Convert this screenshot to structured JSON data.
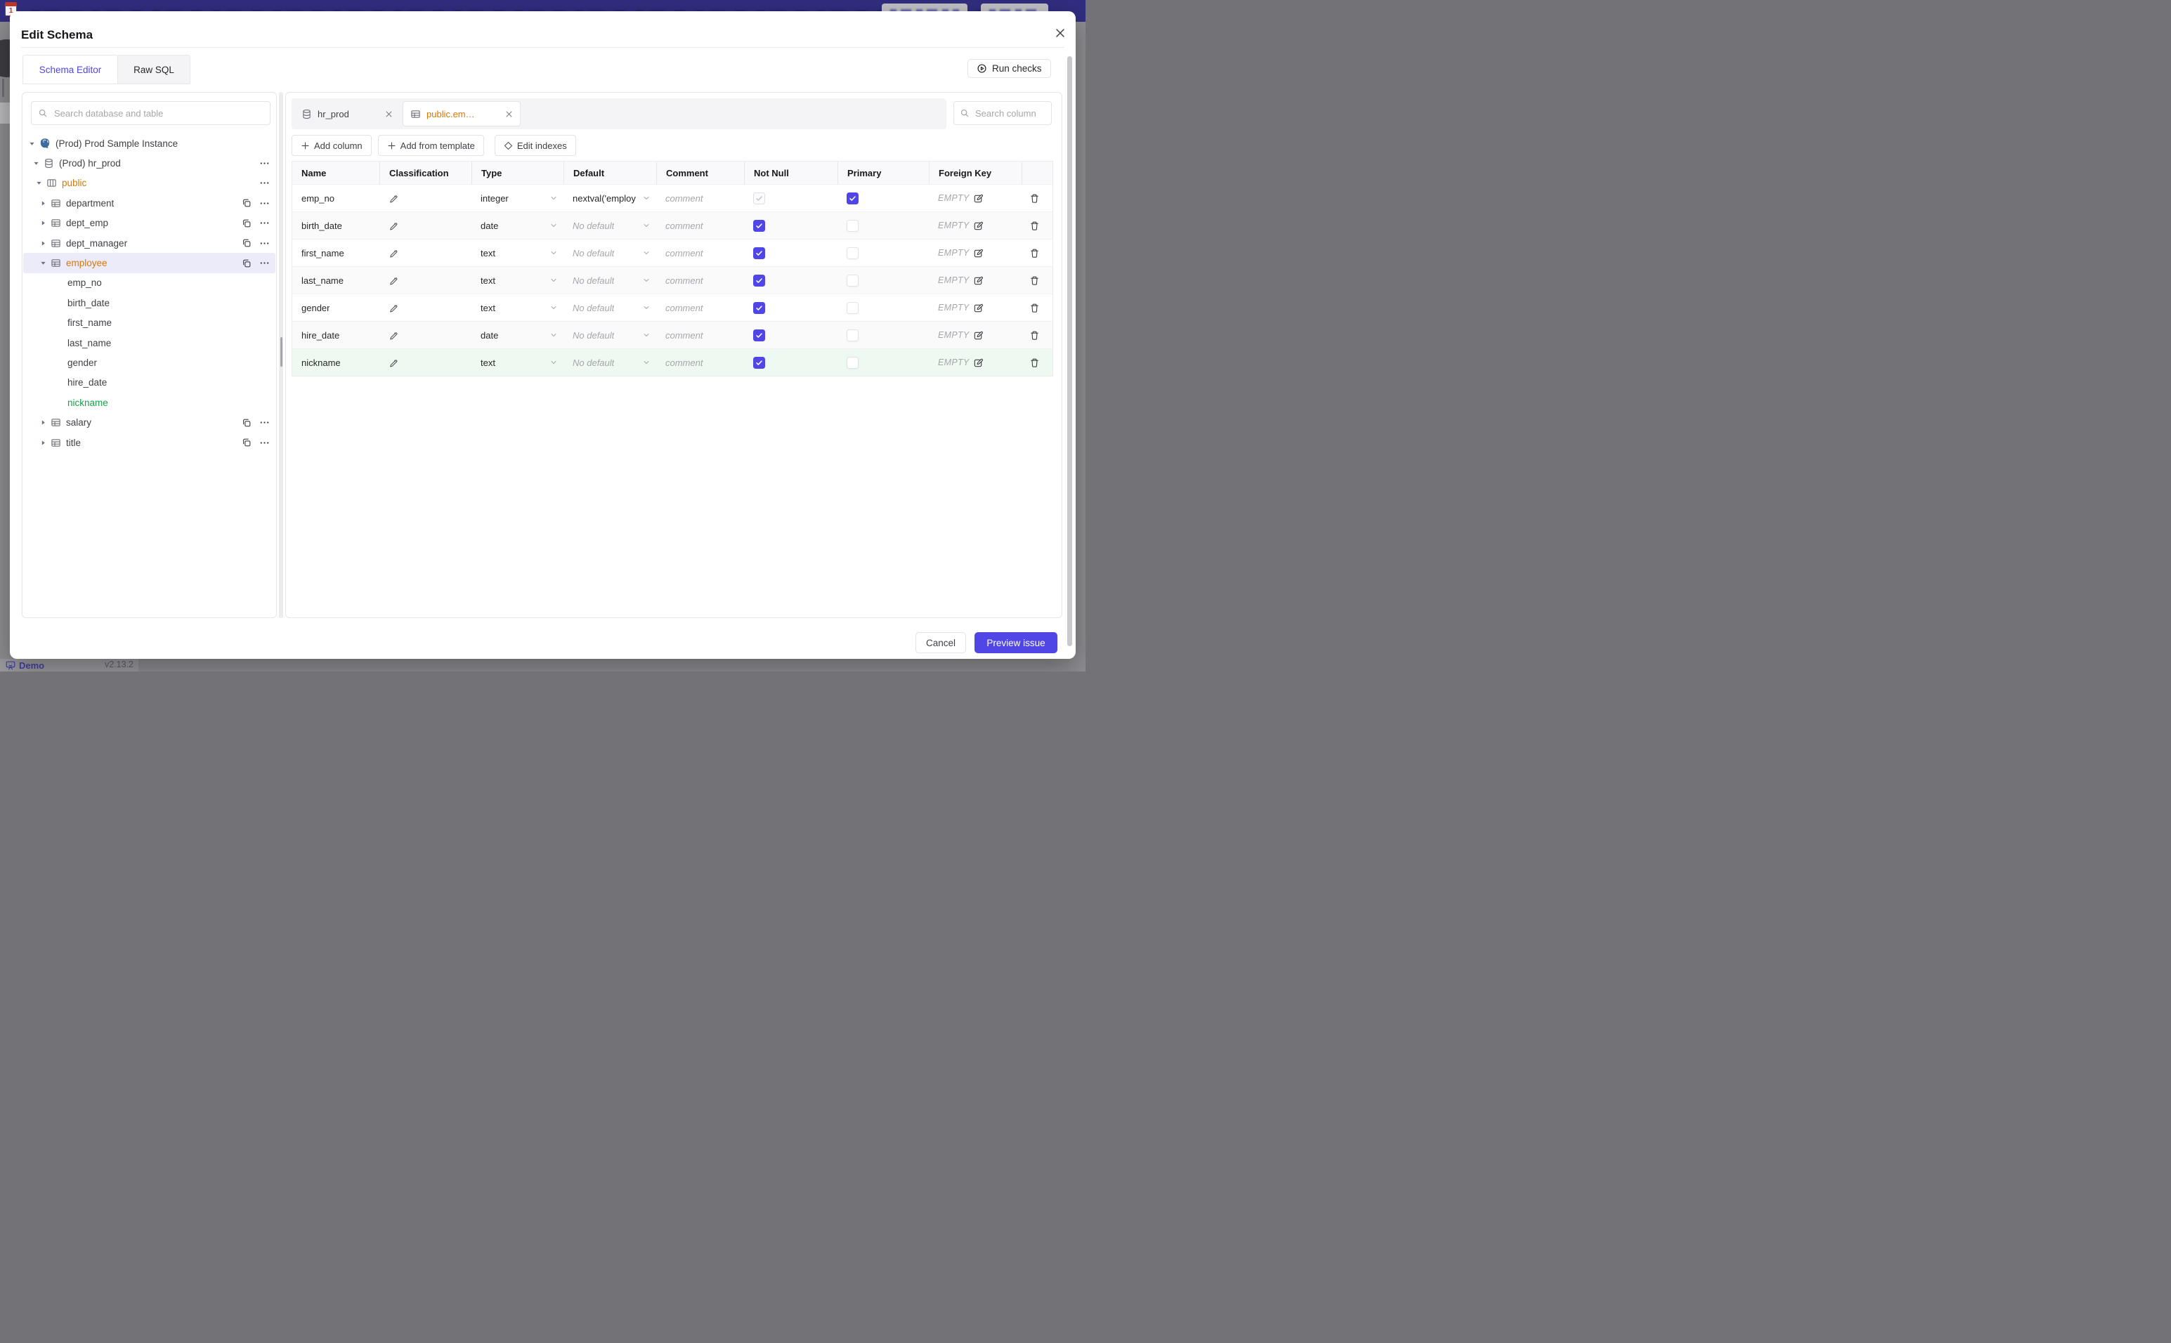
{
  "background": {
    "demo_label": "Demo",
    "version": "v2.13.2",
    "topbar_color": "#312e81"
  },
  "modal": {
    "title": "Edit Schema",
    "tabs": [
      {
        "label": "Schema Editor",
        "active": true
      },
      {
        "label": "Raw SQL",
        "active": false
      }
    ],
    "run_checks_label": "Run checks"
  },
  "sidebar": {
    "search_placeholder": "Search database and table",
    "tree": [
      {
        "level": 1,
        "caret": "down",
        "icon": "postgres-icon",
        "label": "(Prod) Prod Sample Instance"
      },
      {
        "level": 2,
        "caret": "down",
        "icon": "database-icon",
        "label": "(Prod) hr_prod",
        "actions": [
          "ellipsis"
        ]
      },
      {
        "level": 3,
        "caret": "down",
        "icon": "schema-icon",
        "label": "public",
        "color": "amber",
        "actions": [
          "ellipsis"
        ]
      },
      {
        "level": 4,
        "caret": "right",
        "icon": "table-icon",
        "label": "department",
        "actions": [
          "copy",
          "ellipsis"
        ]
      },
      {
        "level": 4,
        "caret": "right",
        "icon": "table-icon",
        "label": "dept_emp",
        "actions": [
          "copy",
          "ellipsis"
        ]
      },
      {
        "level": 4,
        "caret": "right",
        "icon": "table-icon",
        "label": "dept_manager",
        "actions": [
          "copy",
          "ellipsis"
        ]
      },
      {
        "level": 4,
        "caret": "down",
        "icon": "table-icon",
        "label": "employee",
        "color": "amber",
        "selected": true,
        "actions": [
          "copy",
          "ellipsis"
        ]
      },
      {
        "level": 5,
        "label": "emp_no"
      },
      {
        "level": 5,
        "label": "birth_date"
      },
      {
        "level": 5,
        "label": "first_name"
      },
      {
        "level": 5,
        "label": "last_name"
      },
      {
        "level": 5,
        "label": "gender"
      },
      {
        "level": 5,
        "label": "hire_date"
      },
      {
        "level": 5,
        "label": "nickname",
        "color": "green"
      },
      {
        "level": 4,
        "caret": "right",
        "icon": "table-icon",
        "label": "salary",
        "actions": [
          "copy",
          "ellipsis"
        ]
      },
      {
        "level": 4,
        "caret": "right",
        "icon": "table-icon",
        "label": "title",
        "actions": [
          "copy",
          "ellipsis"
        ]
      }
    ]
  },
  "editor": {
    "open_tabs": [
      {
        "label": "hr_prod",
        "icon": "database-icon",
        "active": false
      },
      {
        "label": "public.em…",
        "icon": "table-icon",
        "active": true
      }
    ],
    "toolbar": {
      "add_column": "Add column",
      "add_from_template": "Add from template",
      "edit_indexes": "Edit indexes"
    },
    "column_search_placeholder": "Search column",
    "table": {
      "headers": [
        "Name",
        "Classification",
        "Type",
        "Default",
        "Comment",
        "Not Null",
        "Primary",
        "Foreign Key",
        ""
      ],
      "comment_placeholder": "comment",
      "no_default_label": "No default",
      "foreign_key_label": "EMPTY",
      "rows": [
        {
          "name": "emp_no",
          "type": "integer",
          "default": "nextval('employ",
          "default_muted": false,
          "not_null": {
            "checked": true,
            "disabled": true
          },
          "primary": true,
          "new": false
        },
        {
          "name": "birth_date",
          "type": "date",
          "default": "No default",
          "default_muted": true,
          "not_null": {
            "checked": true,
            "disabled": false
          },
          "primary": false,
          "new": false
        },
        {
          "name": "first_name",
          "type": "text",
          "default": "No default",
          "default_muted": true,
          "not_null": {
            "checked": true,
            "disabled": false
          },
          "primary": false,
          "new": false
        },
        {
          "name": "last_name",
          "type": "text",
          "default": "No default",
          "default_muted": true,
          "not_null": {
            "checked": true,
            "disabled": false
          },
          "primary": false,
          "new": false
        },
        {
          "name": "gender",
          "type": "text",
          "default": "No default",
          "default_muted": true,
          "not_null": {
            "checked": true,
            "disabled": false
          },
          "primary": false,
          "new": false
        },
        {
          "name": "hire_date",
          "type": "date",
          "default": "No default",
          "default_muted": true,
          "not_null": {
            "checked": true,
            "disabled": false
          },
          "primary": false,
          "new": false
        },
        {
          "name": "nickname",
          "type": "text",
          "default": "No default",
          "default_muted": true,
          "not_null": {
            "checked": true,
            "disabled": false
          },
          "primary": false,
          "new": true
        }
      ]
    }
  },
  "footer": {
    "cancel_label": "Cancel",
    "primary_label": "Preview issue"
  },
  "colors": {
    "accent_indigo": "#4f46e5",
    "amber_text": "#d97706",
    "green_text": "#16a34a",
    "new_row_bg": "#edf9f1",
    "selected_tree_bg": "#ecebfa"
  }
}
